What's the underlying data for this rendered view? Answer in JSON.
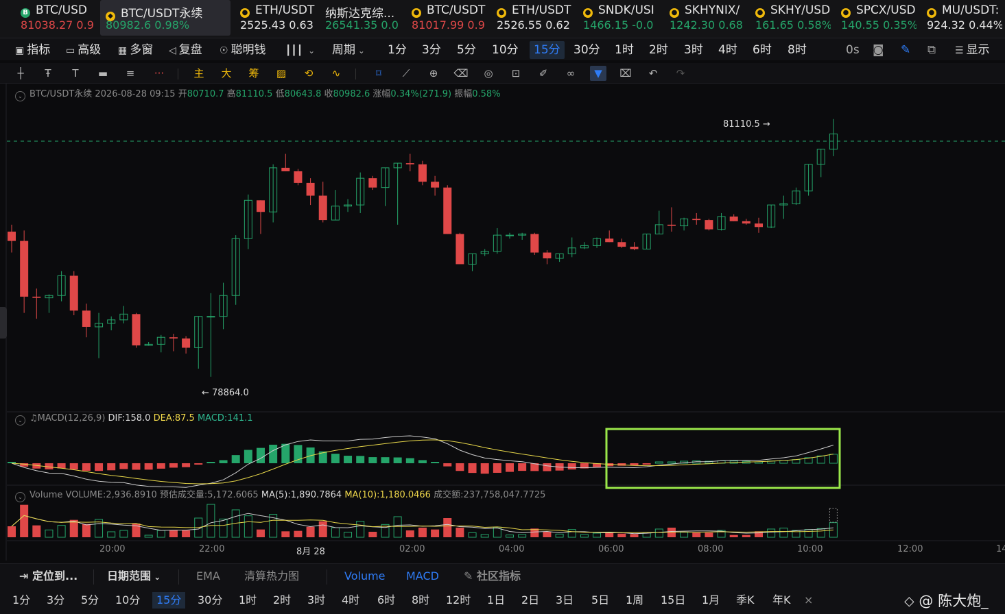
{
  "tickers": [
    {
      "name": "BTC/USD",
      "icon": "bitcoin-icon",
      "price": "81038.27",
      "change": "0.9",
      "color": "#e04848"
    },
    {
      "name": "BTC/USDT永续",
      "icon": "binance-icon",
      "price": "80982.6",
      "change": "0.98%",
      "color": "#25a56a",
      "active": true
    },
    {
      "name": "ETH/USDT",
      "icon": "coin-icon",
      "price": "2525.43",
      "change": "0.63",
      "color": "#e6e6e6"
    },
    {
      "name": "纳斯达克综...",
      "icon": "",
      "price": "26541.35",
      "change": "0.0",
      "color": "#25a56a"
    },
    {
      "name": "BTC/USDT",
      "icon": "coin-icon",
      "price": "81017.99",
      "change": "0.9",
      "color": "#e04848"
    },
    {
      "name": "ETH/USDT",
      "icon": "coin-icon",
      "price": "2526.55",
      "change": "0.62",
      "color": "#e6e6e6"
    },
    {
      "name": "SNDK/USI",
      "icon": "coin-icon",
      "price": "1466.15",
      "change": "-0.0",
      "color": "#25a56a"
    },
    {
      "name": "SKHYNIX/",
      "icon": "coin-icon",
      "price": "1242.30",
      "change": "0.68",
      "color": "#25a56a"
    },
    {
      "name": "SKHY/USD",
      "icon": "coin-icon",
      "price": "161.65",
      "change": "0.58%",
      "color": "#25a56a"
    },
    {
      "name": "SPCX/USD",
      "icon": "coin-icon",
      "price": "140.55",
      "change": "0.35%",
      "color": "#25a56a"
    },
    {
      "name": "MU/USDT:",
      "icon": "coin-icon",
      "price": "924.32",
      "change": "0.44%",
      "color": "#e6e6e6"
    }
  ],
  "toolbar": {
    "indicators": "指标",
    "advanced": "高级",
    "multiwin": "多窗",
    "replay": "复盘",
    "smartmoney": "聪明钱",
    "period": "周期",
    "intervals": [
      "1分",
      "3分",
      "5分",
      "10分",
      "15分",
      "30分",
      "1时",
      "2时",
      "3时",
      "4时",
      "6时",
      "8时"
    ],
    "active_interval": "15分",
    "countdown": "0s",
    "display": "显示"
  },
  "drawtools": {
    "main": "主",
    "big": "大",
    "chips": "筹"
  },
  "chart_info": {
    "symbol": "BTC/USDT永续",
    "datetime": "2026-08-28 09:15",
    "open_label": "开",
    "open": "80710.7",
    "high_label": "高",
    "high": "81110.5",
    "low_label": "低",
    "low": "80643.8",
    "close_label": "收",
    "close": "80982.6",
    "change_label": "涨幅",
    "change": "0.34%(271.9)",
    "amp_label": "振幅",
    "amp": "0.58%",
    "high_marker": "81110.5",
    "low_marker": "78864.0"
  },
  "macd": {
    "name": "MACD(12,26,9)",
    "dif": "DIF:158.0",
    "dea": "DEA:87.5",
    "macd": "MACD:141.1"
  },
  "volume": {
    "name": "Volume",
    "vol": "VOLUME:2,936.8910",
    "est": "预估成交量:5,172.6065",
    "ma5": "MA(5):1,890.7864",
    "ma10": "MA(10):1,180.0466",
    "turnover": "成交额:237,758,047.7725"
  },
  "time_labels": [
    "20:00",
    "22:00",
    "8月 28",
    "02:00",
    "04:00",
    "06:00",
    "08:00",
    "10:00",
    "12:00",
    "14"
  ],
  "bottom1": {
    "locate": "定位到...",
    "range": "日期范围",
    "ema": "EMA",
    "heatmap": "清算热力图",
    "volume": "Volume",
    "macd": "MACD",
    "community": "社区指标"
  },
  "bottom2": {
    "intervals": [
      "1分",
      "3分",
      "5分",
      "10分",
      "15分",
      "30分",
      "1时",
      "2时",
      "3时",
      "4时",
      "6时",
      "8时",
      "12时",
      "1日",
      "2日",
      "3日",
      "5日",
      "1周",
      "15日",
      "1月",
      "季K",
      "年K"
    ],
    "active": "15分"
  },
  "watermark": "@ 陈大炮_",
  "colors": {
    "up": "#25a56a",
    "down": "#e04848",
    "accent": "#2f7cf6",
    "highlight": "#9be84a",
    "dea": "#e8d84a"
  },
  "chart_data": {
    "type": "candlestick",
    "interval": "15m",
    "ylim": [
      78700,
      81250
    ],
    "high_line": 81110.5,
    "candles": [
      [
        80140,
        80200,
        79960,
        80060
      ],
      [
        80060,
        80150,
        79440,
        79580
      ],
      [
        79580,
        79650,
        79390,
        79570
      ],
      [
        79570,
        79600,
        79440,
        79590
      ],
      [
        79590,
        79800,
        79540,
        79760
      ],
      [
        79760,
        79800,
        79420,
        79460
      ],
      [
        79460,
        79520,
        79230,
        79320
      ],
      [
        79320,
        79440,
        79050,
        79350
      ],
      [
        79350,
        79410,
        79290,
        79380
      ],
      [
        79380,
        79500,
        79350,
        79430
      ],
      [
        79430,
        79440,
        79140,
        79160
      ],
      [
        79160,
        79190,
        79160,
        79170
      ],
      [
        79170,
        79250,
        79100,
        79230
      ],
      [
        79230,
        79260,
        79110,
        79220
      ],
      [
        79220,
        79240,
        79090,
        79140
      ],
      [
        79140,
        79380,
        78960,
        79410
      ],
      [
        79410,
        79610,
        78890,
        79410
      ],
      [
        79410,
        79700,
        79300,
        79590
      ],
      [
        79590,
        80110,
        79510,
        80080
      ],
      [
        80080,
        80460,
        79990,
        80410
      ],
      [
        80410,
        80290,
        80120,
        80310
      ],
      [
        80310,
        80720,
        80220,
        80690
      ],
      [
        80690,
        80810,
        80680,
        80660
      ],
      [
        80660,
        80680,
        80540,
        80560
      ],
      [
        80560,
        80600,
        80370,
        80450
      ],
      [
        80450,
        80570,
        80220,
        80240
      ],
      [
        80240,
        80500,
        80290,
        80360
      ],
      [
        80360,
        80420,
        80310,
        80370
      ],
      [
        80370,
        80650,
        80300,
        80600
      ],
      [
        80600,
        80620,
        80500,
        80520
      ],
      [
        80520,
        80640,
        80360,
        80690
      ],
      [
        80690,
        80650,
        80200,
        80730
      ],
      [
        80730,
        80810,
        80660,
        80720
      ],
      [
        80720,
        80750,
        80540,
        80570
      ],
      [
        80570,
        80620,
        80450,
        80520
      ],
      [
        80520,
        80540,
        80120,
        80120
      ],
      [
        80120,
        80130,
        79920,
        79860
      ],
      [
        79860,
        79900,
        79800,
        79950
      ],
      [
        79950,
        79990,
        79930,
        79970
      ],
      [
        79970,
        80170,
        79950,
        80110
      ],
      [
        80110,
        80130,
        80080,
        80110
      ],
      [
        80110,
        80130,
        80070,
        80120
      ],
      [
        80120,
        80130,
        79940,
        79960
      ],
      [
        79960,
        79980,
        79860,
        79910
      ],
      [
        79910,
        79950,
        79880,
        79950
      ],
      [
        79950,
        80090,
        79920,
        80000
      ],
      [
        80000,
        80050,
        79990,
        80020
      ],
      [
        80020,
        80090,
        80000,
        80080
      ],
      [
        80080,
        80150,
        80050,
        80050
      ],
      [
        80050,
        80080,
        80000,
        80010
      ],
      [
        80010,
        80050,
        79980,
        79990
      ],
      [
        79990,
        80100,
        80000,
        80120
      ],
      [
        80120,
        80320,
        80140,
        80200
      ],
      [
        80200,
        80350,
        80140,
        80190
      ],
      [
        80190,
        80260,
        80150,
        80250
      ],
      [
        80250,
        80300,
        80200,
        80240
      ],
      [
        80240,
        80250,
        80150,
        80160
      ],
      [
        80160,
        80300,
        80150,
        80270
      ],
      [
        80270,
        80290,
        80240,
        80230
      ],
      [
        80230,
        80250,
        80200,
        80210
      ],
      [
        80210,
        80260,
        80130,
        80180
      ],
      [
        80180,
        80350,
        80170,
        80370
      ],
      [
        80370,
        80450,
        80250,
        80380
      ],
      [
        80380,
        80520,
        80370,
        80490
      ],
      [
        80490,
        80620,
        80450,
        80720
      ],
      [
        80720,
        80800,
        80610,
        80850
      ],
      [
        80850,
        81110,
        80790,
        80982
      ]
    ]
  }
}
